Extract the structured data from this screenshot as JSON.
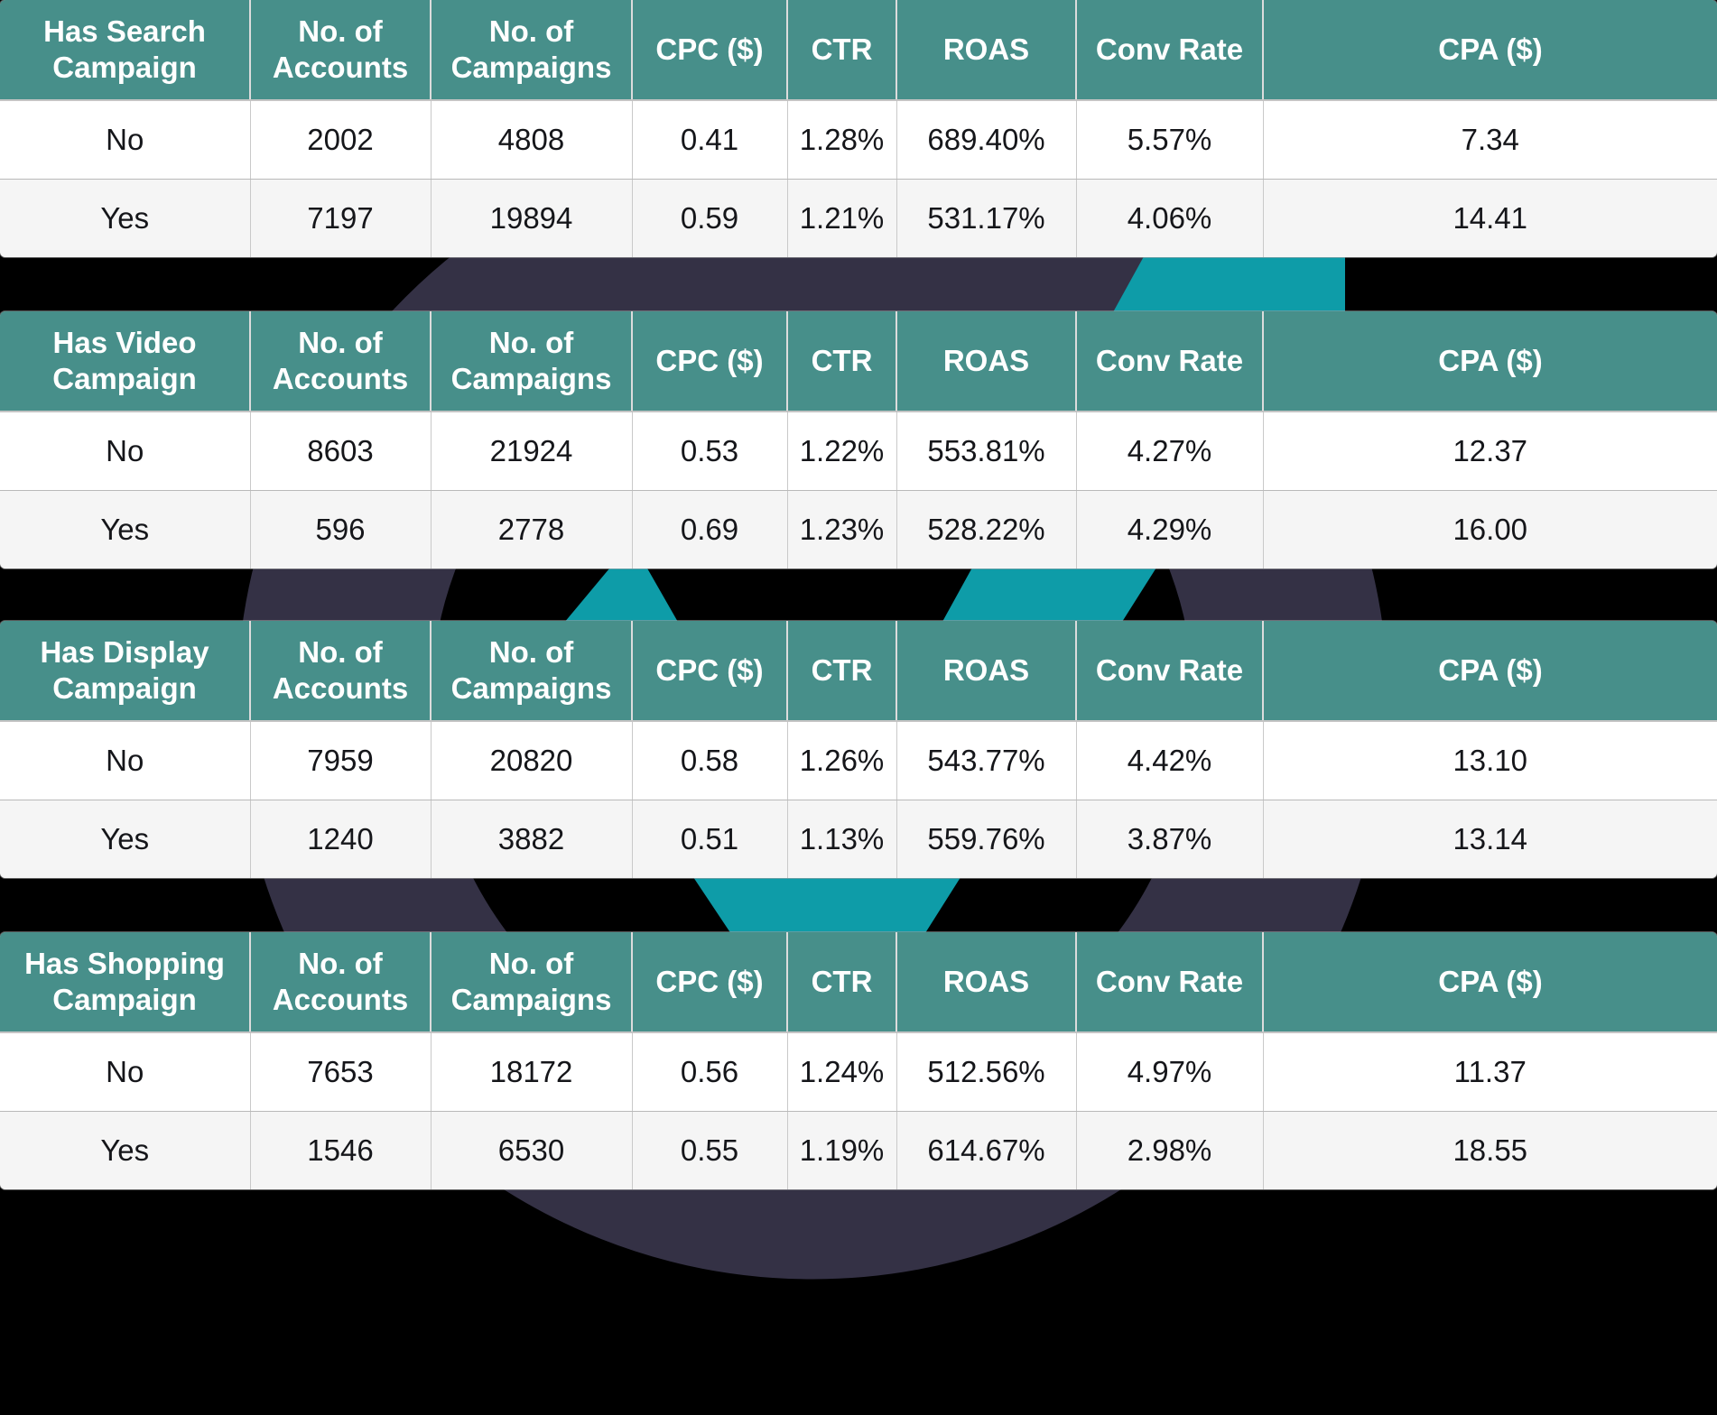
{
  "theme": {
    "header_bg": "#478F8A",
    "header_text": "#FFFFFF",
    "page_bg": "#000000",
    "row_odd_bg": "#FFFFFF",
    "row_even_bg": "#F5F5F5",
    "cell_text": "#15161A",
    "watermark_navy": "#343145",
    "watermark_teal": "#0E9CA8",
    "watermark_light": "#E9F4F5"
  },
  "tables": [
    {
      "id": "has-search-campaign",
      "columns": [
        "Has Search Campaign",
        "No. of Accounts",
        "No. of Campaigns",
        "CPC ($)",
        "CTR",
        "ROAS",
        "Conv Rate",
        "CPA ($)"
      ],
      "rows": [
        [
          "No",
          "2002",
          "4808",
          "0.41",
          "1.28%",
          "689.40%",
          "5.57%",
          "7.34"
        ],
        [
          "Yes",
          "7197",
          "19894",
          "0.59",
          "1.21%",
          "531.17%",
          "4.06%",
          "14.41"
        ]
      ]
    },
    {
      "id": "has-video-campaign",
      "columns": [
        "Has Video Campaign",
        "No. of Accounts",
        "No. of Campaigns",
        "CPC ($)",
        "CTR",
        "ROAS",
        "Conv Rate",
        "CPA ($)"
      ],
      "rows": [
        [
          "No",
          "8603",
          "21924",
          "0.53",
          "1.22%",
          "553.81%",
          "4.27%",
          "12.37"
        ],
        [
          "Yes",
          "596",
          "2778",
          "0.69",
          "1.23%",
          "528.22%",
          "4.29%",
          "16.00"
        ]
      ]
    },
    {
      "id": "has-display-campaign",
      "columns": [
        "Has Display Campaign",
        "No. of Accounts",
        "No. of Campaigns",
        "CPC ($)",
        "CTR",
        "ROAS",
        "Conv Rate",
        "CPA ($)"
      ],
      "rows": [
        [
          "No",
          "7959",
          "20820",
          "0.58",
          "1.26%",
          "543.77%",
          "4.42%",
          "13.10"
        ],
        [
          "Yes",
          "1240",
          "3882",
          "0.51",
          "1.13%",
          "559.76%",
          "3.87%",
          "13.14"
        ]
      ]
    },
    {
      "id": "has-shopping-campaign",
      "columns": [
        "Has Shopping Campaign",
        "No. of Accounts",
        "No. of Campaigns",
        "CPC ($)",
        "CTR",
        "ROAS",
        "Conv Rate",
        "CPA ($)"
      ],
      "rows": [
        [
          "No",
          "7653",
          "18172",
          "0.56",
          "1.24%",
          "512.56%",
          "4.97%",
          "11.37"
        ],
        [
          "Yes",
          "1546",
          "6530",
          "0.55",
          "1.19%",
          "614.67%",
          "2.98%",
          "18.55"
        ]
      ]
    }
  ],
  "chart_data": {
    "type": "table",
    "title": "Google Ads performance benchmarks by campaign type presence",
    "tables": [
      {
        "name": "Has Search Campaign",
        "categories": [
          "No",
          "Yes"
        ],
        "series": [
          {
            "name": "No. of Accounts",
            "values": [
              2002,
              7197
            ]
          },
          {
            "name": "No. of Campaigns",
            "values": [
              4808,
              19894
            ]
          },
          {
            "name": "CPC ($)",
            "values": [
              0.41,
              0.59
            ]
          },
          {
            "name": "CTR",
            "values": [
              1.28,
              1.21
            ]
          },
          {
            "name": "ROAS",
            "values": [
              689.4,
              531.17
            ]
          },
          {
            "name": "Conv Rate",
            "values": [
              5.57,
              4.06
            ]
          },
          {
            "name": "CPA ($)",
            "values": [
              7.34,
              14.41
            ]
          }
        ]
      },
      {
        "name": "Has Video Campaign",
        "categories": [
          "No",
          "Yes"
        ],
        "series": [
          {
            "name": "No. of Accounts",
            "values": [
              8603,
              596
            ]
          },
          {
            "name": "No. of Campaigns",
            "values": [
              21924,
              2778
            ]
          },
          {
            "name": "CPC ($)",
            "values": [
              0.53,
              0.69
            ]
          },
          {
            "name": "CTR",
            "values": [
              1.22,
              1.23
            ]
          },
          {
            "name": "ROAS",
            "values": [
              553.81,
              528.22
            ]
          },
          {
            "name": "Conv Rate",
            "values": [
              4.27,
              4.29
            ]
          },
          {
            "name": "CPA ($)",
            "values": [
              12.37,
              16.0
            ]
          }
        ]
      },
      {
        "name": "Has Display Campaign",
        "categories": [
          "No",
          "Yes"
        ],
        "series": [
          {
            "name": "No. of Accounts",
            "values": [
              7959,
              1240
            ]
          },
          {
            "name": "No. of Campaigns",
            "values": [
              20820,
              3882
            ]
          },
          {
            "name": "CPC ($)",
            "values": [
              0.58,
              0.51
            ]
          },
          {
            "name": "CTR",
            "values": [
              1.26,
              1.13
            ]
          },
          {
            "name": "ROAS",
            "values": [
              543.77,
              559.76
            ]
          },
          {
            "name": "Conv Rate",
            "values": [
              4.42,
              3.87
            ]
          },
          {
            "name": "CPA ($)",
            "values": [
              13.1,
              13.14
            ]
          }
        ]
      },
      {
        "name": "Has Shopping Campaign",
        "categories": [
          "No",
          "Yes"
        ],
        "series": [
          {
            "name": "No. of Accounts",
            "values": [
              7653,
              1546
            ]
          },
          {
            "name": "No. of Campaigns",
            "values": [
              18172,
              6530
            ]
          },
          {
            "name": "CPC ($)",
            "values": [
              0.56,
              0.55
            ]
          },
          {
            "name": "CTR",
            "values": [
              1.24,
              1.19
            ]
          },
          {
            "name": "ROAS",
            "values": [
              512.56,
              614.67
            ]
          },
          {
            "name": "Conv Rate",
            "values": [
              4.97,
              2.98
            ]
          },
          {
            "name": "CPA ($)",
            "values": [
              11.37,
              18.55
            ]
          }
        ]
      }
    ]
  }
}
